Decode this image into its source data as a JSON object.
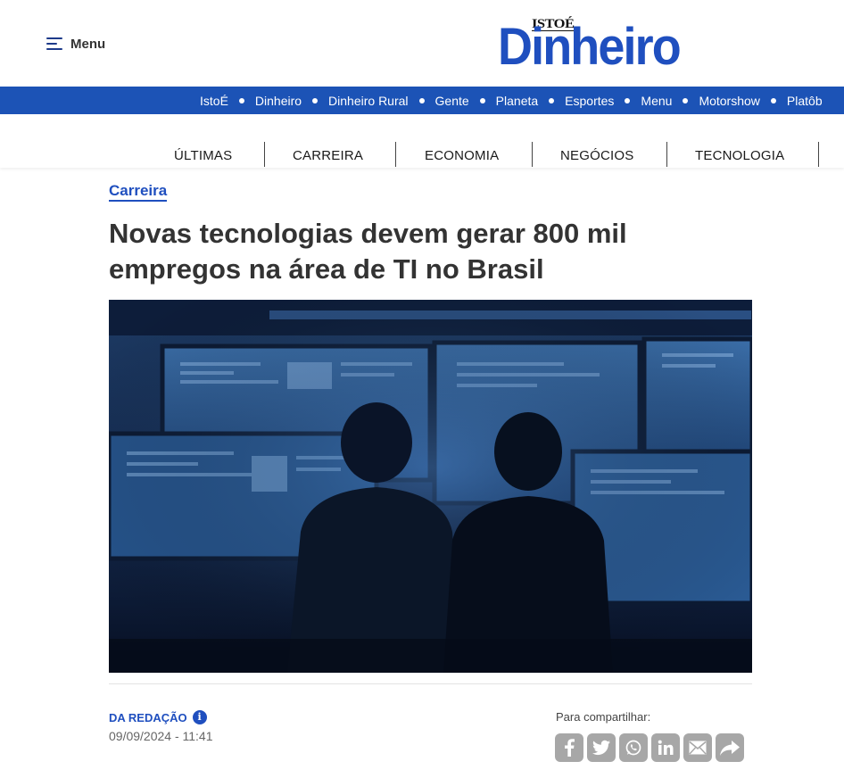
{
  "header": {
    "menu_label": "Menu",
    "logo_small": "ISTOÉ",
    "logo_main": "Dinheiro"
  },
  "top_nav": [
    "IstoÉ",
    "Dinheiro",
    "Dinheiro Rural",
    "Gente",
    "Planeta",
    "Esportes",
    "Menu",
    "Motorshow",
    "Platôb"
  ],
  "section_nav": [
    "ÚLTIMAS",
    "CARREIRA",
    "ECONOMIA",
    "NEGÓCIOS",
    "TECNOLOGIA"
  ],
  "article": {
    "category": "Carreira",
    "title": "Novas tecnologias devem gerar 800 mil empregos na área de TI no Brasil",
    "author": "DA REDAÇÃO",
    "info_icon": "i",
    "date": "09/09/2024 - 11:41"
  },
  "share": {
    "label": "Para compartilhar:",
    "icons": [
      "facebook-icon",
      "twitter-icon",
      "whatsapp-icon",
      "linkedin-icon",
      "email-icon",
      "share-icon"
    ]
  },
  "colors": {
    "brand_blue": "#1f4fbf",
    "nav_blue": "#1c53b6",
    "share_gray": "#a7a7a7"
  }
}
